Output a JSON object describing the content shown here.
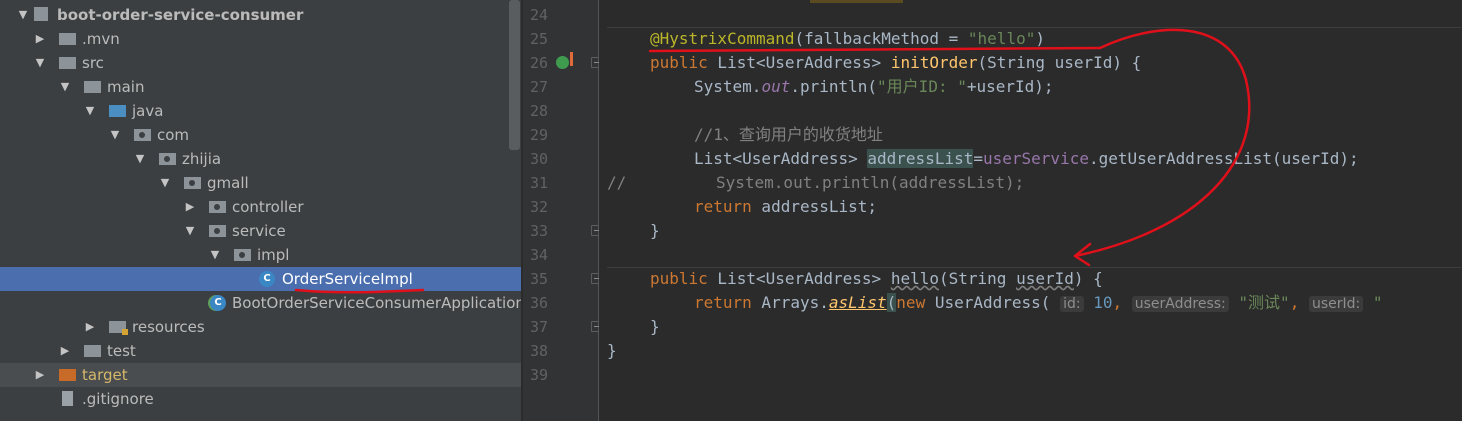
{
  "project_tree": {
    "project_name": "boot-order-service-consumer",
    "items": [
      {
        "label": ".mvn"
      },
      {
        "label": "src"
      },
      {
        "label": "main"
      },
      {
        "label": "java"
      },
      {
        "label": "com"
      },
      {
        "label": "zhijia"
      },
      {
        "label": "gmall"
      },
      {
        "label": "controller"
      },
      {
        "label": "service"
      },
      {
        "label": "impl"
      },
      {
        "label": "OrderServiceImpl"
      },
      {
        "label": "BootOrderServiceConsumerApplication"
      },
      {
        "label": "resources"
      },
      {
        "label": "test"
      },
      {
        "label": "target"
      },
      {
        "label": ".gitignore"
      }
    ],
    "class_icon_letter": "C"
  },
  "editor": {
    "line_numbers": [
      "24",
      "25",
      "26",
      "27",
      "28",
      "29",
      "30",
      "31",
      "32",
      "33",
      "34",
      "35",
      "36",
      "37",
      "38",
      "39"
    ],
    "code": {
      "l25_annotation": "@HystrixCommand",
      "l25_open": "(",
      "l25_attr": "fallbackMethod",
      "l25_eq": " = ",
      "l25_value": "\"hello\"",
      "l25_close": ")",
      "l26_public": "public",
      "l26_type": " List<UserAddress> ",
      "l26_method": "initOrder",
      "l26_params": "(String userId) {",
      "l27_pre": "System.",
      "l27_out": "out",
      "l27_call": ".println(",
      "l27_str": "\"用户ID: \"",
      "l27_post": "+userId);",
      "l29_comment": "//1、查询用户的收货地址",
      "l30_type": "List<UserAddress> ",
      "l30_var": "addressList",
      "l30_eq": "=",
      "l30_field": "userService",
      "l30_rest": ".getUserAddressList(userId);",
      "l31_prefix": "//",
      "l31_code": "System.out.println(addressList);",
      "l32_return": "return",
      "l32_rest": " addressList;",
      "l33": "}",
      "l35_public": "public",
      "l35_type": " List<UserAddress> ",
      "l35_method": "hello",
      "l35_open": "(String ",
      "l35_param": "userId",
      "l35_close": ") {",
      "l36_return": "return",
      "l36_arrays": " Arrays.",
      "l36_aslist": "asList",
      "l36_paren": "(",
      "l36_new": "new",
      "l36_ctor": " UserAddress(",
      "l36_hint_id": "id:",
      "l36_num": "10",
      "l36_comma": ",",
      "l36_hint_ua": "userAddress:",
      "l36_str": "\"测试\"",
      "l36_hint_uid": "userId:",
      "l36_tail": "\"",
      "l37": "}",
      "l38": "}"
    }
  },
  "colors": {
    "editor_bg": "#2b2b2b",
    "tree_bg": "#3c3f41",
    "selection": "#4b6eaf",
    "keyword": "#cc7832",
    "annotation": "#bbb529",
    "string": "#6a8759",
    "hand_drawn_marks": "#e0101a"
  },
  "icons": [
    "chevron-right-icon",
    "chevron-down-icon",
    "folder-icon",
    "package-icon",
    "class-icon",
    "spring-boot-app-icon",
    "file-icon",
    "implementing-method-icon",
    "fold-marker-icon"
  ]
}
